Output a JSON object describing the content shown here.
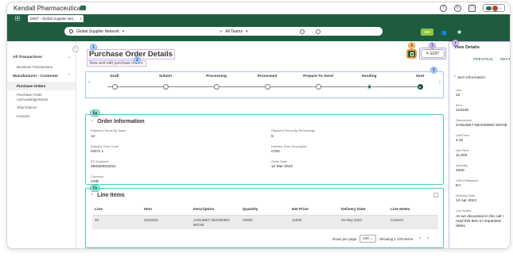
{
  "app": {
    "brand": "Kendall Pharmaceuticals",
    "tab_label": "MINT - Global Supplier Net...",
    "tab_close": "×"
  },
  "search": {
    "network": "Global Supplier Network",
    "teams": "All Teams",
    "go": "GO"
  },
  "sidebar": {
    "sections": [
      {
        "label": "All Transactions",
        "items": [
          {
            "label": "Business Transactions"
          }
        ]
      },
      {
        "label": "Manufacturer - Customer",
        "items": [
          {
            "label": "Purchase Orders"
          },
          {
            "label": "Purchase Order Acknowledgements"
          },
          {
            "label": "Ship Notices"
          },
          {
            "label": "Invoices"
          }
        ]
      }
    ]
  },
  "page": {
    "title": "Purchase Order Details",
    "subtitle": "View and edit purchase orders.",
    "edit_label": "EDIT"
  },
  "badges": {
    "b1": "1",
    "b2": "2",
    "b3": "3",
    "b4": "4",
    "b5": "5",
    "b6a": "6a",
    "b6b": "6b",
    "b7": "7"
  },
  "steps": [
    {
      "label": "Draft"
    },
    {
      "label": "Submit"
    },
    {
      "label": "Processing"
    },
    {
      "label": "Processed"
    },
    {
      "label": "Prepare To Send"
    },
    {
      "label": "Sending"
    },
    {
      "label": "Sent"
    }
  ],
  "order_info": {
    "title": "Order Information",
    "fields": {
      "payment_days_label": "Payment Terms By Days",
      "payment_days_value": "14",
      "payment_pct_label": "Payment Terms By Percentage",
      "payment_pct_value": "5",
      "delivery_code_label": "Delivery Term Code",
      "delivery_code_value": "INCO 1",
      "delivery_desc_label": "Delivery Term Description",
      "delivery_desc_value": "COD",
      "po_number_label": "PO Number*",
      "po_number_value": "260320010011",
      "order_date_label": "Order Date",
      "order_date_value": "12 Mar 2024",
      "currency_label": "Currency",
      "currency_value": "USD"
    }
  },
  "line_items": {
    "title": "Line Items",
    "columns": [
      "Line",
      "Item",
      "Description",
      "Quantity",
      "Net Price",
      "Delivery Date",
      "Line Notes"
    ],
    "rows": [
      [
        "10",
        "2342523",
        "JANUMET 50/1000MG 56TAB",
        "20000",
        "11000",
        "02 May 2024",
        "Content"
      ]
    ],
    "pager": {
      "rows_per_page_label": "Rows per page",
      "rows_per_page_value": "100",
      "showing": "Showing 1-100 items"
    }
  },
  "details_panel": {
    "title": "View Details",
    "previous": "PREVIOUS",
    "next": "NEXT",
    "section": "Item Information",
    "fields": {
      "line_label": "Line",
      "line_value": "10",
      "item_label": "Item",
      "item_value": "123246",
      "desc_label": "Description",
      "desc_value": "JANUMET 50/1000MG 56TAB",
      "unit_price_label": "Unit Price",
      "unit_price_value": "4.31",
      "net_price_label": "Net Price",
      "net_price_value": "11,000",
      "quantity_label": "Quantity",
      "quantity_value": "2000",
      "uom_label": "Unit of Measure",
      "uom_value": "EA",
      "delivery_label": "Delivery Date",
      "delivery_value": "12 Apr 2024",
      "notes_label": "Line Notes",
      "notes_value": "As we discussed in the call I read this item in requested dates."
    }
  },
  "colors": {
    "brand_green": "#1f5c3f",
    "go_green": "#8dc63f",
    "badge_blue": "#b8d4ff",
    "badge_purple": "#d8c6f5",
    "badge_orange": "#f7c27d",
    "badge_teal": "#a8e6df"
  }
}
